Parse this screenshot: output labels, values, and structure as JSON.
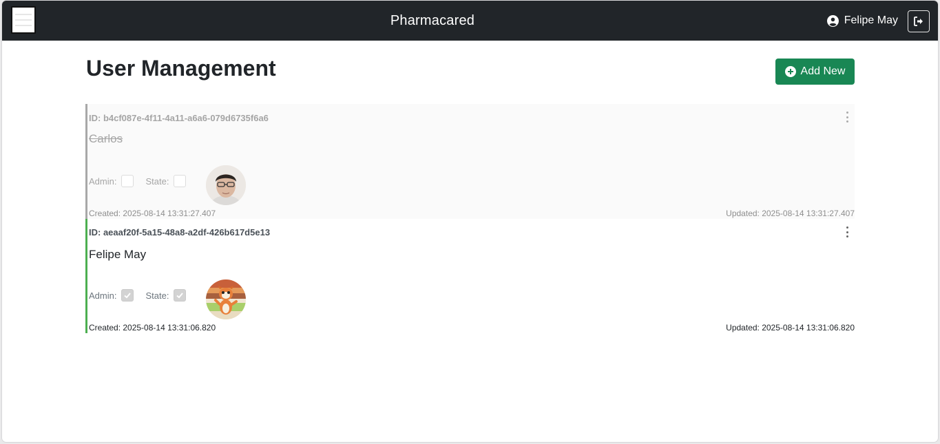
{
  "app": {
    "brand": "Pharmacared",
    "user_name": "Felipe May"
  },
  "page": {
    "title": "User Management",
    "add_button_label": "Add New"
  },
  "users": [
    {
      "id_label": "ID: b4cf087e-4f11-4a11-a6a6-079d6735f6a6",
      "name": "Carlos",
      "admin_label": "Admin:",
      "state_label": "State:",
      "admin": false,
      "state": false,
      "created": "Created: 2025-08-14 13:31:27.407",
      "updated": "Updated: 2025-08-14 13:31:27.407"
    },
    {
      "id_label": "ID: aeaaf20f-5a15-48a8-a2df-426b617d5e13",
      "name": "Felipe May",
      "admin_label": "Admin:",
      "state_label": "State:",
      "admin": true,
      "state": true,
      "created": "Created: 2025-08-14 13:31:06.820",
      "updated": "Updated: 2025-08-14 13:31:06.820"
    }
  ],
  "colors": {
    "navbar": "#212529",
    "add_button": "#198754",
    "active_accent": "#4caf50",
    "inactive_accent": "#a8a8a8"
  },
  "icons": {
    "menu": "hamburger-icon",
    "user": "user-circle-icon",
    "logout": "logout-icon",
    "add": "plus-circle-icon",
    "more": "kebab-icon"
  }
}
